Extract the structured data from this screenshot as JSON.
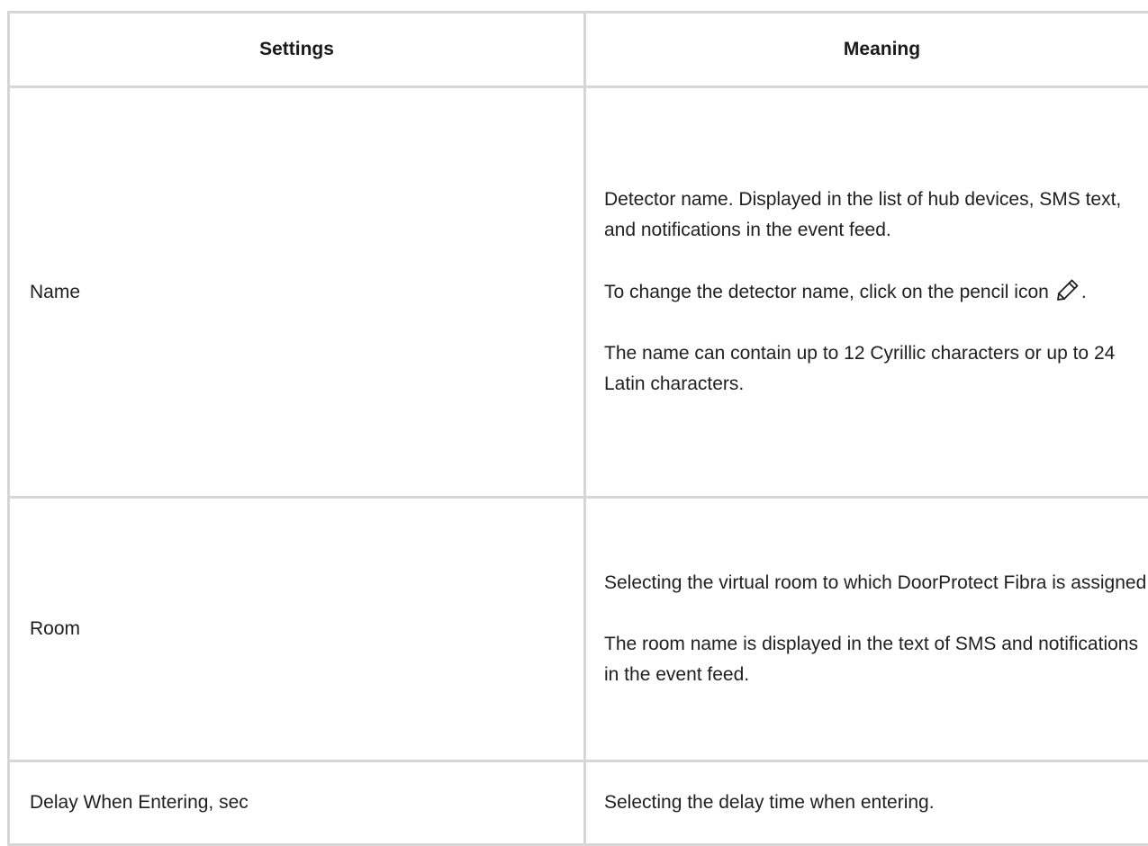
{
  "table": {
    "headers": {
      "settings": "Settings",
      "meaning": "Meaning"
    },
    "rows": [
      {
        "setting": "Name",
        "meaning": [
          "Detector name. Displayed in the list of hub devices, SMS text, and notifications in the event feed.",
          "To change the detector name, click on the pencil icon",
          "The name can contain up to 12 Cyrillic characters or up to 24 Latin characters."
        ],
        "meaning_suffix": ".",
        "icon": "pencil-icon"
      },
      {
        "setting": "Room",
        "meaning": [
          "Selecting the virtual room to which DoorProtect Fibra is assigned.",
          "The room name is displayed in the text of SMS and notifications in the event feed."
        ]
      },
      {
        "setting": "Delay When Entering, sec",
        "meaning": [
          "Selecting the delay time when entering."
        ]
      }
    ]
  },
  "colors": {
    "border": "#d6d6d6",
    "text": "#1f1f1f"
  }
}
